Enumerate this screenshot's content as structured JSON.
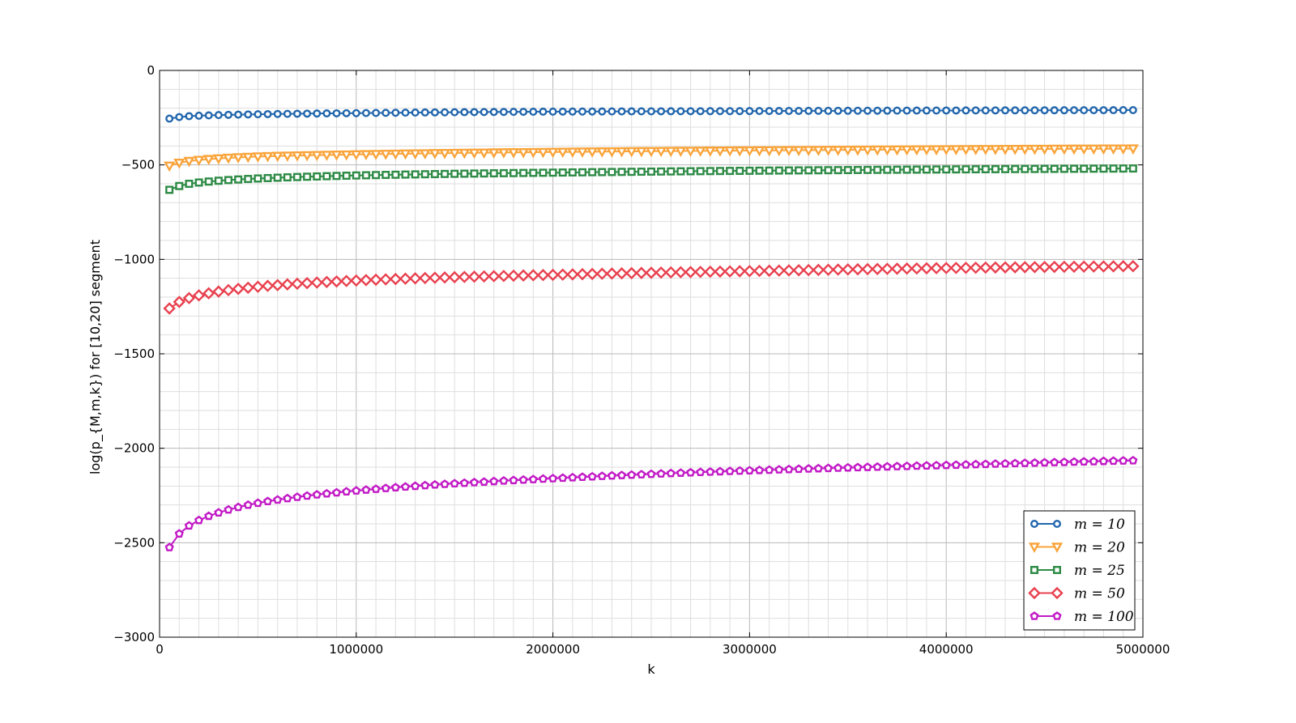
{
  "chart_data": {
    "type": "line",
    "xlabel": "k",
    "ylabel": "log(p_{M,m,k}) for [10,20] segment",
    "xlim": [
      0,
      5000000
    ],
    "ylim": [
      -3000,
      0
    ],
    "xticks": [
      0,
      1000000,
      2000000,
      3000000,
      4000000,
      5000000
    ],
    "yticks": [
      0,
      -500,
      -1000,
      -1500,
      -2000,
      -2500,
      -3000
    ],
    "x_start": 50000,
    "x_step": 50000,
    "num_points": 99,
    "grid": true,
    "legend_position": "bottom-right",
    "series": [
      {
        "name": "m = 10",
        "marker": "circle",
        "color": "#2166ac",
        "values_at": {
          "50000": -255,
          "150000": -242,
          "500000": -232,
          "1000000": -226,
          "2000000": -218,
          "3000000": -215,
          "4000000": -212,
          "4950000": -210
        }
      },
      {
        "name": "m = 20",
        "marker": "triangle-down",
        "color": "#f9a43b",
        "values_at": {
          "50000": -505,
          "150000": -480,
          "500000": -456,
          "1000000": -445,
          "2000000": -432,
          "3000000": -424,
          "4000000": -418,
          "4950000": -414
        }
      },
      {
        "name": "m = 25",
        "marker": "square",
        "color": "#2e8b46",
        "values_at": {
          "50000": -632,
          "150000": -600,
          "500000": -572,
          "1000000": -556,
          "2000000": -541,
          "3000000": -531,
          "4000000": -524,
          "4950000": -519
        }
      },
      {
        "name": "m = 50",
        "marker": "diamond",
        "color": "#e8414f",
        "values_at": {
          "50000": -1260,
          "150000": -1205,
          "500000": -1145,
          "1000000": -1112,
          "2000000": -1082,
          "3000000": -1062,
          "4000000": -1046,
          "4950000": -1036
        }
      },
      {
        "name": "m = 100",
        "marker": "pentagon",
        "color": "#c21bc6",
        "values_at": {
          "50000": -2525,
          "150000": -2410,
          "500000": -2290,
          "1000000": -2225,
          "2000000": -2160,
          "3000000": -2118,
          "4000000": -2090,
          "4950000": -2065
        }
      }
    ]
  }
}
